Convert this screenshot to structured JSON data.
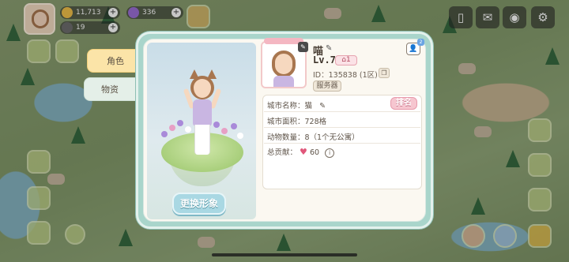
{
  "hud": {
    "coins": "11,713",
    "gems": "336",
    "secondary": "19"
  },
  "tabs": [
    {
      "label": "角色"
    },
    {
      "label": "物资"
    }
  ],
  "portrait": {
    "change_button": "更换形象"
  },
  "profile": {
    "name": "喵",
    "level": "Lv.7",
    "home_count": "1",
    "id_label": "ID：",
    "id_value": "135838",
    "zone": "(1区)",
    "server_button": "服务器"
  },
  "info": {
    "city_name_label": "城市名称：",
    "city_name_value": "猫",
    "rank_button": "排名",
    "city_area_label": "城市面积：",
    "city_area_value": "728格",
    "animals_label": "动物数量：",
    "animals_value": "8（1个无公寓）",
    "contribution_label": "总贡献：",
    "contribution_value": "60"
  },
  "colors": {
    "modal_border": "#a9d5cb",
    "tab_active": "#fbe4a8",
    "rank_pink": "#f6c6d0",
    "heart": "#e0577a"
  }
}
